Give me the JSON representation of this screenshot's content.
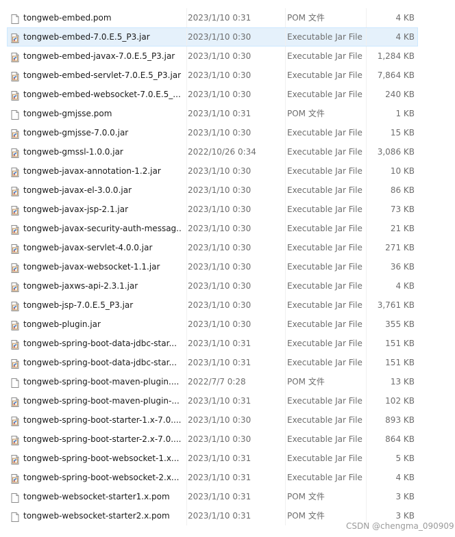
{
  "files": [
    {
      "name": "tongweb-embed.pom",
      "date": "2023/1/10 0:31",
      "type": "POM 文件",
      "size": "4 KB",
      "icon": "pom-file-icon"
    },
    {
      "name": "tongweb-embed-7.0.E.5_P3.jar",
      "date": "2023/1/10 0:30",
      "type": "Executable Jar File",
      "size": "4 KB",
      "icon": "jar-file-icon"
    },
    {
      "name": "tongweb-embed-javax-7.0.E.5_P3.jar",
      "date": "2023/1/10 0:30",
      "type": "Executable Jar File",
      "size": "1,284 KB",
      "icon": "jar-file-icon"
    },
    {
      "name": "tongweb-embed-servlet-7.0.E.5_P3.jar",
      "date": "2023/1/10 0:30",
      "type": "Executable Jar File",
      "size": "7,864 KB",
      "icon": "jar-file-icon"
    },
    {
      "name": "tongweb-embed-websocket-7.0.E.5_...",
      "date": "2023/1/10 0:30",
      "type": "Executable Jar File",
      "size": "240 KB",
      "icon": "jar-file-icon"
    },
    {
      "name": "tongweb-gmjsse.pom",
      "date": "2023/1/10 0:31",
      "type": "POM 文件",
      "size": "1 KB",
      "icon": "pom-file-icon"
    },
    {
      "name": "tongweb-gmjsse-7.0.0.jar",
      "date": "2023/1/10 0:30",
      "type": "Executable Jar File",
      "size": "15 KB",
      "icon": "jar-file-icon"
    },
    {
      "name": "tongweb-gmssl-1.0.0.jar",
      "date": "2022/10/26 0:34",
      "type": "Executable Jar File",
      "size": "3,086 KB",
      "icon": "jar-file-icon"
    },
    {
      "name": "tongweb-javax-annotation-1.2.jar",
      "date": "2023/1/10 0:30",
      "type": "Executable Jar File",
      "size": "10 KB",
      "icon": "jar-file-icon"
    },
    {
      "name": "tongweb-javax-el-3.0.0.jar",
      "date": "2023/1/10 0:30",
      "type": "Executable Jar File",
      "size": "86 KB",
      "icon": "jar-file-icon"
    },
    {
      "name": "tongweb-javax-jsp-2.1.jar",
      "date": "2023/1/10 0:30",
      "type": "Executable Jar File",
      "size": "73 KB",
      "icon": "jar-file-icon"
    },
    {
      "name": "tongweb-javax-security-auth-messag...",
      "date": "2023/1/10 0:30",
      "type": "Executable Jar File",
      "size": "21 KB",
      "icon": "jar-file-icon"
    },
    {
      "name": "tongweb-javax-servlet-4.0.0.jar",
      "date": "2023/1/10 0:30",
      "type": "Executable Jar File",
      "size": "271 KB",
      "icon": "jar-file-icon"
    },
    {
      "name": "tongweb-javax-websocket-1.1.jar",
      "date": "2023/1/10 0:30",
      "type": "Executable Jar File",
      "size": "36 KB",
      "icon": "jar-file-icon"
    },
    {
      "name": "tongweb-jaxws-api-2.3.1.jar",
      "date": "2023/1/10 0:30",
      "type": "Executable Jar File",
      "size": "4 KB",
      "icon": "jar-file-icon"
    },
    {
      "name": "tongweb-jsp-7.0.E.5_P3.jar",
      "date": "2023/1/10 0:30",
      "type": "Executable Jar File",
      "size": "3,761 KB",
      "icon": "jar-file-icon"
    },
    {
      "name": "tongweb-plugin.jar",
      "date": "2023/1/10 0:30",
      "type": "Executable Jar File",
      "size": "355 KB",
      "icon": "jar-file-icon"
    },
    {
      "name": "tongweb-spring-boot-data-jdbc-star...",
      "date": "2023/1/10 0:31",
      "type": "Executable Jar File",
      "size": "151 KB",
      "icon": "jar-file-icon"
    },
    {
      "name": "tongweb-spring-boot-data-jdbc-star...",
      "date": "2023/1/10 0:31",
      "type": "Executable Jar File",
      "size": "151 KB",
      "icon": "jar-file-icon"
    },
    {
      "name": "tongweb-spring-boot-maven-plugin....",
      "date": "2022/7/7 0:28",
      "type": "POM 文件",
      "size": "13 KB",
      "icon": "pom-file-icon"
    },
    {
      "name": "tongweb-spring-boot-maven-plugin-...",
      "date": "2023/1/10 0:31",
      "type": "Executable Jar File",
      "size": "102 KB",
      "icon": "jar-file-icon"
    },
    {
      "name": "tongweb-spring-boot-starter-1.x-7.0....",
      "date": "2023/1/10 0:30",
      "type": "Executable Jar File",
      "size": "893 KB",
      "icon": "jar-file-icon"
    },
    {
      "name": "tongweb-spring-boot-starter-2.x-7.0....",
      "date": "2023/1/10 0:30",
      "type": "Executable Jar File",
      "size": "864 KB",
      "icon": "jar-file-icon"
    },
    {
      "name": "tongweb-spring-boot-websocket-1.x...",
      "date": "2023/1/10 0:31",
      "type": "Executable Jar File",
      "size": "5 KB",
      "icon": "jar-file-icon"
    },
    {
      "name": "tongweb-spring-boot-websocket-2.x...",
      "date": "2023/1/10 0:31",
      "type": "Executable Jar File",
      "size": "4 KB",
      "icon": "jar-file-icon"
    },
    {
      "name": "tongweb-websocket-starter1.x.pom",
      "date": "2023/1/10 0:31",
      "type": "POM 文件",
      "size": "3 KB",
      "icon": "pom-file-icon"
    },
    {
      "name": "tongweb-websocket-starter2.x.pom",
      "date": "2023/1/10 0:31",
      "type": "POM 文件",
      "size": "3 KB",
      "icon": "pom-file-icon"
    }
  ],
  "selected_index": 1,
  "watermark": "CSDN @chengma_090909",
  "colors": {
    "selection_bg": "#e5f1fb",
    "selection_border": "#cce8ff",
    "secondary_text": "#6d6d6d",
    "jar_icon_accent": "#2b6fc7"
  }
}
